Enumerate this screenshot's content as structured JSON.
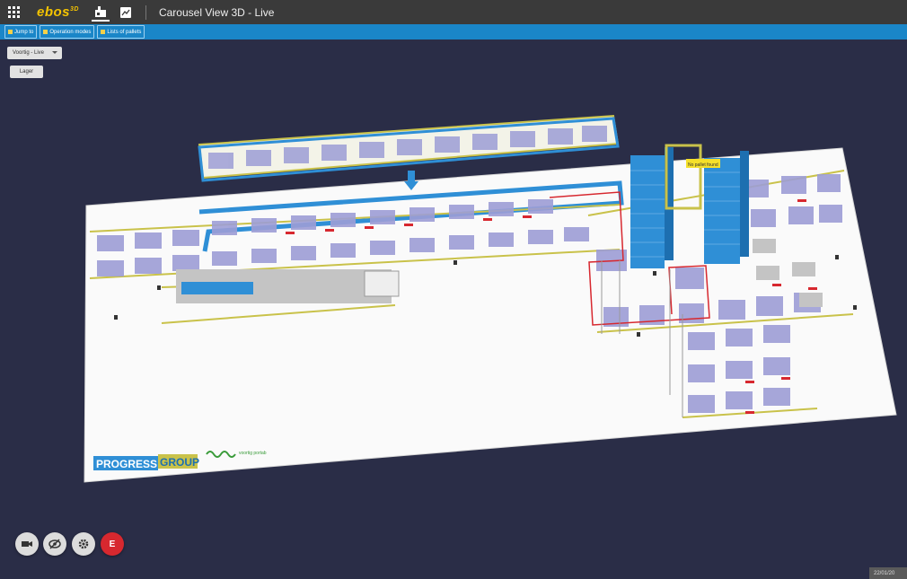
{
  "header": {
    "logo": "ebos",
    "logo_sup": "3D",
    "title": "Carousel View 3D - Live"
  },
  "toolbar": {
    "jump_to": "Jump to",
    "operation_modes": "Operation modes",
    "lists_of_pallets": "Lists of pallets"
  },
  "view_select": {
    "value": "Voortig - Live"
  },
  "layer_button": "Lager",
  "scene": {
    "brand_progress": "PROGRESS",
    "brand_group": "GROUP",
    "partner_text": "voortig portab",
    "warning_label": "No pallet found"
  },
  "fab": {
    "e_label": "E"
  },
  "footer": {
    "datestamp": "22/01/20"
  },
  "colors": {
    "topbar": "#3a3a3a",
    "toolbar": "#1a86c8",
    "background": "#2a2d47",
    "logo": "#f5c400",
    "pallet": "#9d9ed6",
    "rack": "#2f8fd6",
    "rail": "#c9c24a",
    "alert": "#d7282f"
  }
}
